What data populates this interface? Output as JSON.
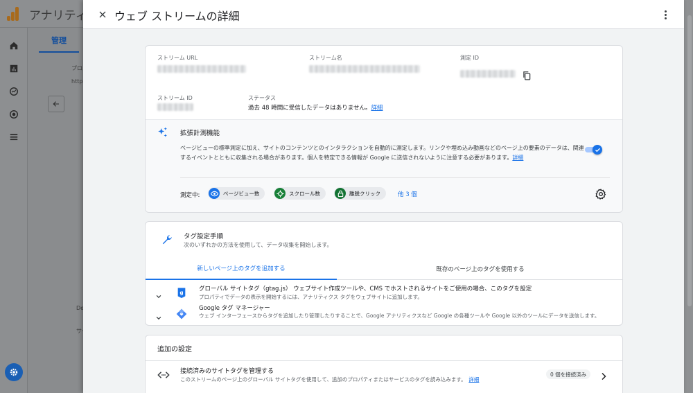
{
  "background_app": {
    "title": "アナリティ",
    "admin_tab": "管理",
    "left_texts": [
      "プロパ",
      "http:/",
      "De",
      "サー"
    ]
  },
  "drawer": {
    "title": "ウェブ ストリームの詳細",
    "close_icon": "close-icon",
    "more_icon": "more-vert-icon"
  },
  "stream_details": {
    "stream_url_label": "ストリーム URL",
    "stream_name_label": "ストリーム名",
    "measurement_id_label": "測定 ID",
    "stream_id_label": "ストリーム ID",
    "status_label": "ステータス",
    "status_text": "過去 48 時間に受信したデータはありません。",
    "status_link": "詳細"
  },
  "enhanced_measurement": {
    "title": "拡張計測機能",
    "description": "ページビューの標準測定に加え、サイトのコンテンツとのインタラクションを自動的に測定します。リンクや埋め込み動画などのページ上の要素のデータは、関連するイベントとともに収集される場合があります。個人を特定できる情報が Google に送信されないように注意する必要があります。",
    "description_link": "詳細",
    "toggle_on": true,
    "measuring_label": "測定中:",
    "chips": [
      {
        "label": "ページビュー数",
        "icon": "eye-icon",
        "color": "#1a73e8"
      },
      {
        "label": "スクロール数",
        "icon": "crosshair-icon",
        "color": "#188038"
      },
      {
        "label": "離脱クリック",
        "icon": "lock-icon",
        "color": "#137333"
      }
    ],
    "more_chips": "他 3 個"
  },
  "tagging": {
    "title": "タグ設定手順",
    "subtitle": "次のいずれかの方法を使用して、データ収集を開始します。",
    "tabs": [
      "新しいページ上のタグを追加する",
      "既存のページ上のタグを使用する"
    ],
    "rows": [
      {
        "title": "グローバル サイトタグ（gtag.js） ウェブサイト作成ツールや、CMS でホストされるサイトをご使用の場合、このタグを設定",
        "desc": "プロパティでデータの表示を開始するには、アナリティクス タグをウェブサイトに追加します。"
      },
      {
        "title": "Google タグ マネージャー",
        "desc": "ウェブ インターフェースからタグを追加したり管理したりすることで、Google アナリティクスなど Google の各種ツールや Google 以外のツールにデータを送信します。"
      }
    ]
  },
  "additional_settings": {
    "title": "追加の設定",
    "connected_title": "接続済みのサイトタグを管理する",
    "connected_desc": "このストリームのページ上のグローバル サイトタグを使用して、追加のプロパティまたはサービスのタグを読み込みます。",
    "connected_link": "詳細",
    "connected_badge": "0 個を接続済み"
  },
  "colors": {
    "accent": "#1a73e8",
    "drawer_bg": "#f1f3f4",
    "overlay": "#8a8c8e"
  }
}
